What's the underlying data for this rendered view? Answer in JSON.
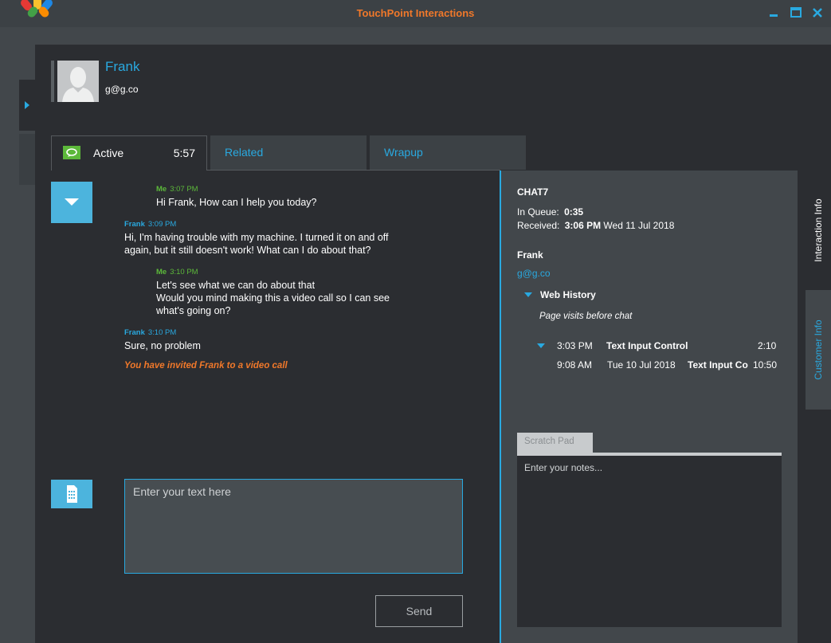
{
  "window": {
    "title": "TouchPoint Interactions"
  },
  "customer": {
    "name": "Frank",
    "email": "g@g.co"
  },
  "tabs": {
    "active_label": "Active",
    "active_timer": "5:57",
    "related_label": "Related",
    "wrapup_label": "Wrapup"
  },
  "messages": [
    {
      "sender": "Me",
      "time": "3:07 PM",
      "lines": [
        "Hi Frank, How can I help you today?"
      ]
    },
    {
      "sender": "Frank",
      "time": "3:09 PM",
      "lines": [
        "Hi, I'm having trouble with my machine. I turned it on and off",
        "again, but it still doesn't work! What can I do about that?"
      ]
    },
    {
      "sender": "Me",
      "time": "3:10 PM",
      "lines": [
        "Let's see what we can do about that",
        "Would you mind making this a video call so I can see",
        "what's going on?"
      ]
    },
    {
      "sender": "Frank",
      "time": "3:10 PM",
      "lines": [
        "Sure, no problem"
      ]
    }
  ],
  "system_note": "You have invited Frank  to a video call",
  "composer": {
    "placeholder": "Enter your text here",
    "send_label": "Send"
  },
  "interaction_info": {
    "channel": "CHAT7",
    "in_queue_label": "In Queue:",
    "in_queue_value": "0:35",
    "received_label": "Received:",
    "received_time": "3:06 PM",
    "received_date": "Wed 11 Jul 2018",
    "customer_name": "Frank",
    "customer_email": "g@g.co",
    "web_history": {
      "title": "Web History",
      "subtitle": "Page visits before chat",
      "rows": [
        {
          "time": "3:03 PM",
          "date": "",
          "page": "Text Input Control",
          "duration": "2:10"
        },
        {
          "time": "9:08 AM",
          "date": "Tue 10 Jul 2018",
          "page": "Text Input Co",
          "duration": "10:50"
        }
      ]
    }
  },
  "scratch_pad": {
    "tab_label": "Scratch Pad",
    "placeholder": "Enter your notes..."
  },
  "side_tabs": {
    "interaction_info": "Interaction Info",
    "customer_info": "Customer Info"
  },
  "colors": {
    "accent_blue": "#29a9e0",
    "accent_orange": "#f0782a",
    "me_green": "#5cb83a",
    "background": "#2b2d31",
    "panel": "#42474b"
  }
}
